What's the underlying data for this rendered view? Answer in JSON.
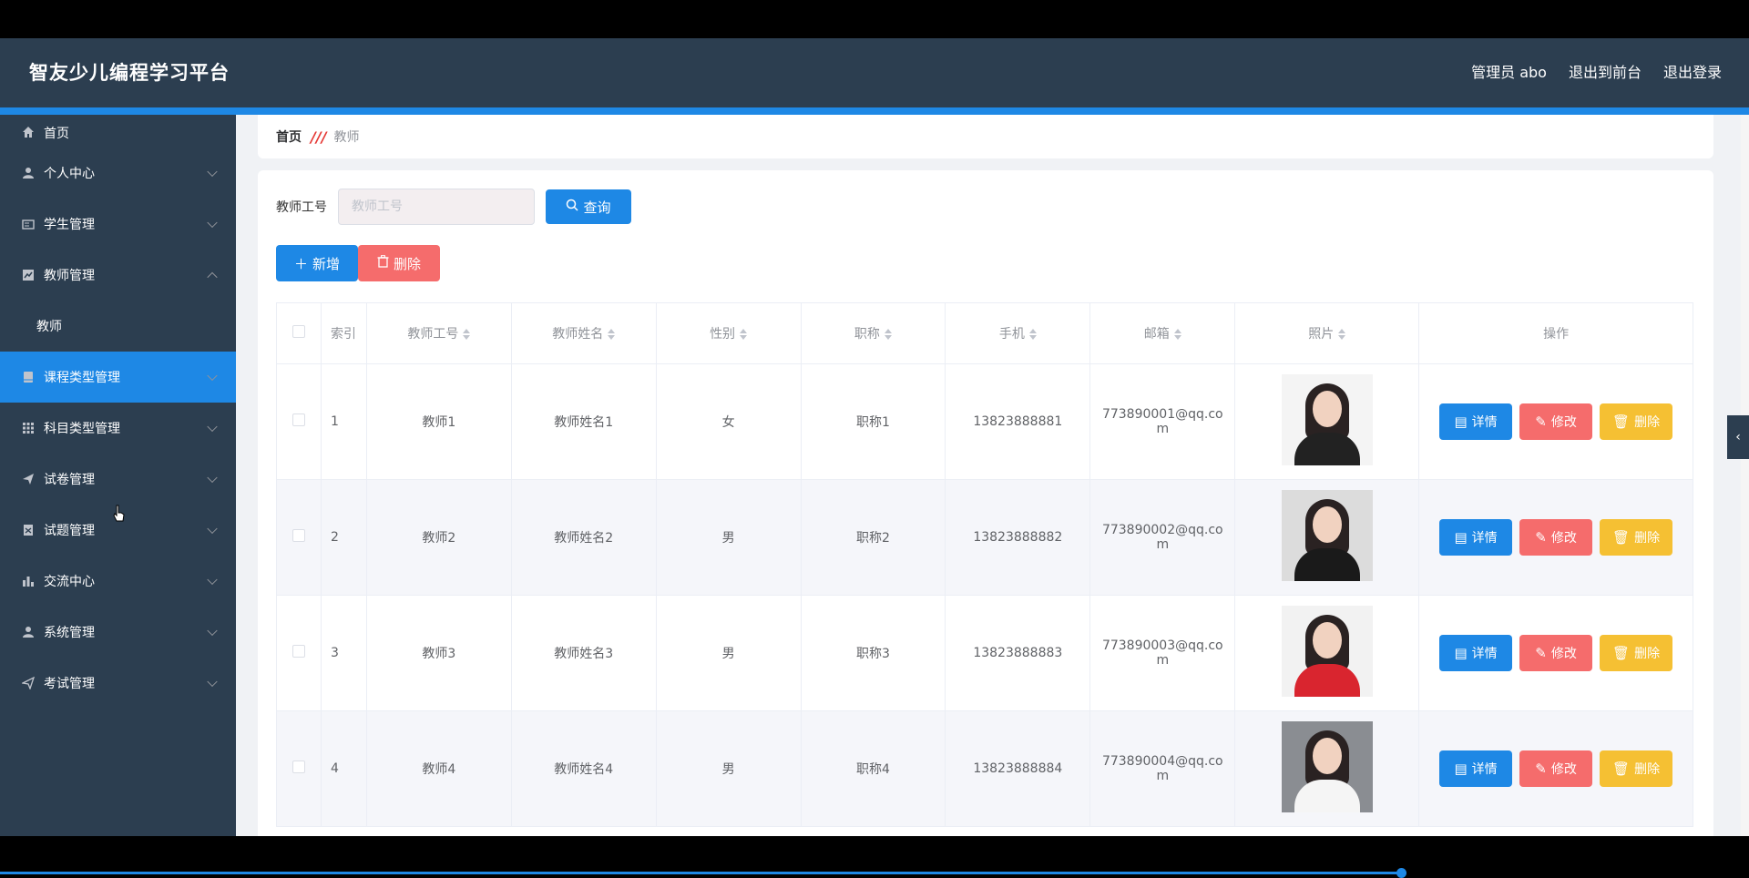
{
  "header": {
    "brand": "智友少儿编程学习平台",
    "admin_label": "管理员 abo",
    "back_to_front": "退出到前台",
    "logout": "退出登录"
  },
  "sidebar": {
    "items": [
      {
        "label": "首页",
        "icon": "home-icon"
      },
      {
        "label": "个人中心",
        "icon": "user-icon"
      },
      {
        "label": "学生管理",
        "icon": "id-card-icon"
      },
      {
        "label": "教师管理",
        "icon": "chart-icon"
      },
      {
        "label": "教师",
        "icon": ""
      },
      {
        "label": "课程类型管理",
        "icon": "book-icon"
      },
      {
        "label": "科目类型管理",
        "icon": "grid-icon"
      },
      {
        "label": "试卷管理",
        "icon": "send-icon"
      },
      {
        "label": "试题管理",
        "icon": "doc-icon"
      },
      {
        "label": "交流中心",
        "icon": "bar-chart-icon"
      },
      {
        "label": "系统管理",
        "icon": "user-icon"
      },
      {
        "label": "考试管理",
        "icon": "send-icon"
      }
    ]
  },
  "breadcrumb": {
    "home": "首页",
    "separator": "///",
    "current": "教师"
  },
  "search": {
    "label": "教师工号",
    "placeholder": "教师工号",
    "query_button": "查询"
  },
  "toolbar": {
    "add_label": "新增",
    "delete_label": "删除"
  },
  "table": {
    "headers": [
      "索引",
      "教师工号",
      "教师姓名",
      "性别",
      "职称",
      "手机",
      "邮箱",
      "照片",
      "操作"
    ],
    "rows": [
      {
        "index": "1",
        "id": "教师1",
        "name": "教师姓名1",
        "gender": "女",
        "title": "职称1",
        "phone": "13823888881",
        "email_a": "773890001@qq.co",
        "email_b": "m"
      },
      {
        "index": "2",
        "id": "教师2",
        "name": "教师姓名2",
        "gender": "男",
        "title": "职称2",
        "phone": "13823888882",
        "email_a": "773890002@qq.co",
        "email_b": "m"
      },
      {
        "index": "3",
        "id": "教师3",
        "name": "教师姓名3",
        "gender": "男",
        "title": "职称3",
        "phone": "13823888883",
        "email_a": "773890003@qq.co",
        "email_b": "m"
      },
      {
        "index": "4",
        "id": "教师4",
        "name": "教师姓名4",
        "gender": "男",
        "title": "职称4",
        "phone": "13823888884",
        "email_a": "773890004@qq.co",
        "email_b": "m"
      }
    ],
    "actions": {
      "detail": "详情",
      "edit": "修改",
      "remove": "删除"
    }
  },
  "colors": {
    "header_bg": "#2c3e50",
    "accent": "#1e88e5",
    "danger": "#f56c6c",
    "warning": "#f5c033"
  }
}
